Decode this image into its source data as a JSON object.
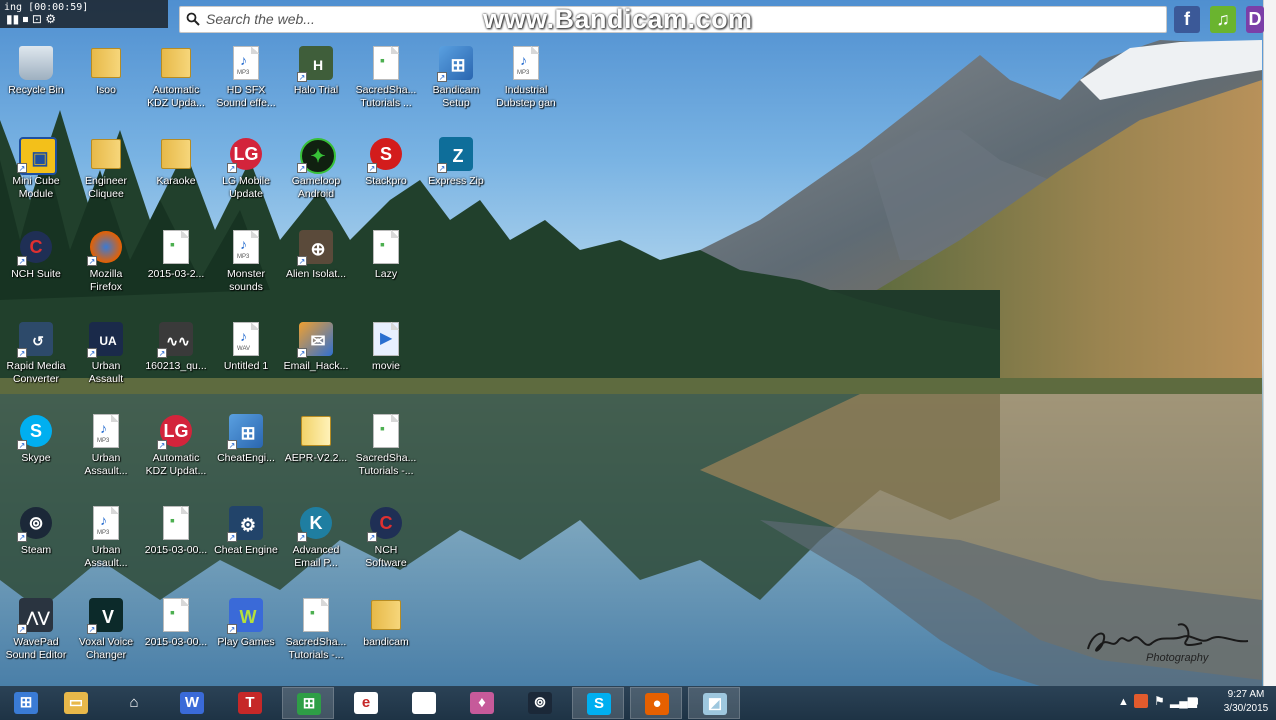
{
  "recorder": {
    "status": "ing [00:00:59]",
    "watermark": "www.Bandicam.com"
  },
  "search": {
    "placeholder": "Search the web..."
  },
  "desktop_icons": [
    {
      "label": "Recycle Bin",
      "icon": "recycle-bin-icon"
    },
    {
      "label": "Isoo",
      "icon": "folder-icon"
    },
    {
      "label": "Automatic\nKDZ Upda...",
      "icon": "folder-icon"
    },
    {
      "label": "HD SFX\nSound effe...",
      "icon": "mp3-file-icon"
    },
    {
      "label": "Halo Trial",
      "icon": "halo-icon"
    },
    {
      "label": "SacredSha...\nTutorials ...",
      "icon": "document-icon"
    },
    {
      "label": "Bandicam\nSetup",
      "icon": "installer-icon"
    },
    {
      "label": "Industrial\nDubstep gan",
      "icon": "mp3-file-icon"
    },
    {
      "label": "Mini Cube\nModule",
      "icon": "cube-icon"
    },
    {
      "label": "Engineer\nCliquee",
      "icon": "folder-icon"
    },
    {
      "label": "Karaoke",
      "icon": "folder-icon"
    },
    {
      "label": "LG Mobile\nUpdate",
      "icon": "lg-icon"
    },
    {
      "label": "Gameloop\nAndroid",
      "icon": "gameloop-icon"
    },
    {
      "label": "Stackpro",
      "icon": "stackpro-icon"
    },
    {
      "label": "Express Zip",
      "icon": "express-zip-icon"
    },
    {
      "label": "NCH Suite",
      "icon": "nch-icon"
    },
    {
      "label": "Mozilla\nFirefox",
      "icon": "firefox-icon"
    },
    {
      "label": "2015-03-2...",
      "icon": "document-icon"
    },
    {
      "label": "Monster\nsounds",
      "icon": "mp3-file-icon"
    },
    {
      "label": "Alien Isolat...",
      "icon": "alien-icon"
    },
    {
      "label": "Lazy",
      "icon": "document-icon"
    },
    {
      "label": "Rapid Media\nConverter",
      "icon": "converter-icon"
    },
    {
      "label": "Urban\nAssault",
      "icon": "urban-assault-icon"
    },
    {
      "label": "160213_qu...",
      "icon": "audio-wave-icon"
    },
    {
      "label": "Untitled 1",
      "icon": "wav-file-icon"
    },
    {
      "label": "Email_Hack...",
      "icon": "email-installer-icon"
    },
    {
      "label": "movie",
      "icon": "movie-file-icon"
    },
    {
      "label": "Skype",
      "icon": "skype-icon"
    },
    {
      "label": "Urban\nAssault...",
      "icon": "mp3-file-icon"
    },
    {
      "label": "Automatic\nKDZ Updat...",
      "icon": "lg-icon"
    },
    {
      "label": "CheatEngi...",
      "icon": "installer-icon"
    },
    {
      "label": "AEPR-V2.2...",
      "icon": "folder-open-icon"
    },
    {
      "label": "SacredSha...\nTutorials -...",
      "icon": "document-icon"
    },
    {
      "label": "Steam",
      "icon": "steam-icon"
    },
    {
      "label": "Urban\nAssault...",
      "icon": "mp3-file-icon"
    },
    {
      "label": "2015-03-00...",
      "icon": "document-icon"
    },
    {
      "label": "Cheat Engine",
      "icon": "cheat-engine-icon"
    },
    {
      "label": "Advanced\nEmail P...",
      "icon": "kangaroo-icon"
    },
    {
      "label": "NCH\nSoftware",
      "icon": "nch-icon"
    },
    {
      "label": "WavePad\nSound Editor",
      "icon": "wavepad-icon"
    },
    {
      "label": "Voxal Voice\nChanger",
      "icon": "voxal-icon"
    },
    {
      "label": "2015-03-00...",
      "icon": "document-icon"
    },
    {
      "label": "Play Games",
      "icon": "play-games-icon"
    },
    {
      "label": "SacredSha...\nTutorials -...",
      "icon": "document-icon"
    },
    {
      "label": "bandicam",
      "icon": "folder-icon"
    }
  ],
  "signature": {
    "text": "Photography"
  },
  "taskbar": {
    "items": [
      {
        "icon": "windows-start-icon"
      },
      {
        "icon": "file-explorer-icon"
      },
      {
        "icon": "home-icon"
      },
      {
        "icon": "play-games-icon"
      },
      {
        "icon": "t-app-icon"
      },
      {
        "icon": "store-icon"
      },
      {
        "icon": "ebay-icon"
      },
      {
        "icon": "document-icon"
      },
      {
        "icon": "media-app-icon"
      },
      {
        "icon": "steam-icon"
      },
      {
        "icon": "skype-icon"
      },
      {
        "icon": "firefox-icon"
      },
      {
        "icon": "glass-app-icon"
      }
    ]
  },
  "clock": {
    "time": "9:27 AM",
    "date": "3/30/2015"
  }
}
